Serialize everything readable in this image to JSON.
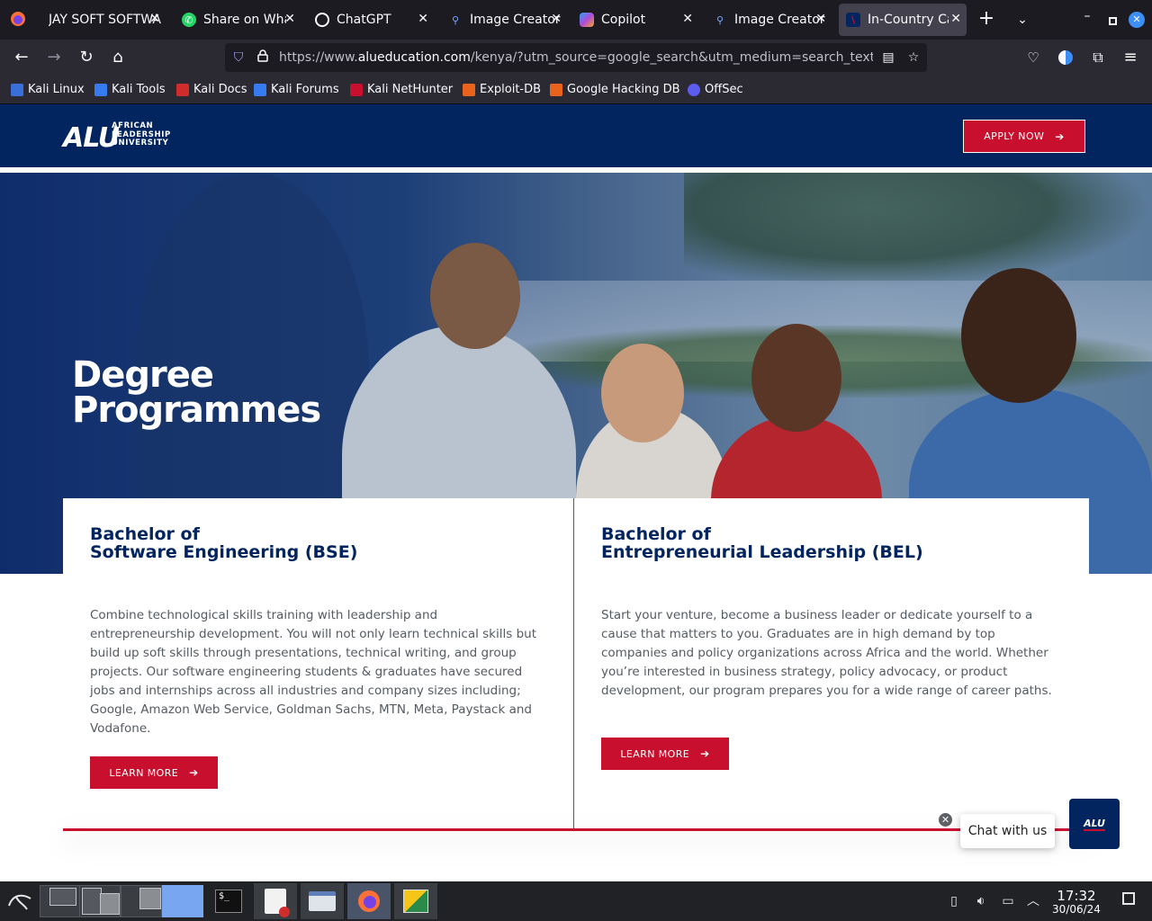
{
  "browser": {
    "tabs": [
      {
        "title": "JAY SOFT SOFTWA",
        "icon": "firefox-icon"
      },
      {
        "title": "Share on Wha",
        "icon": "whatsapp-icon"
      },
      {
        "title": "ChatGPT",
        "icon": "chatgpt-icon"
      },
      {
        "title": "Image Creator",
        "icon": "search-icon"
      },
      {
        "title": "Copilot",
        "icon": "copilot-icon"
      },
      {
        "title": "Image Creator",
        "icon": "search-icon"
      },
      {
        "title": "In-Country Ca",
        "icon": "alu-favicon",
        "active": true
      }
    ],
    "url_prefix": "https://www.",
    "url_domain": "alueducation.com",
    "url_rest": "/kenya/?utm_source=google_search&utm_medium=search_text&utm_",
    "bookmarks": [
      {
        "label": "Kali Linux",
        "color": "#3a6ed8"
      },
      {
        "label": "Kali Tools",
        "color": "#367bf0"
      },
      {
        "label": "Kali Docs",
        "color": "#d02c2c"
      },
      {
        "label": "Kali Forums",
        "color": "#367bf0"
      },
      {
        "label": "Kali NetHunter",
        "color": "#c8102e"
      },
      {
        "label": "Exploit-DB",
        "color": "#e8641c"
      },
      {
        "label": "Google Hacking DB",
        "color": "#e8641c"
      },
      {
        "label": "OffSec",
        "color": "#5c5cf0"
      }
    ]
  },
  "site": {
    "logo_mark": "ALU",
    "logo_line1": "AFRICAN",
    "logo_line2": "LEADERSHIP",
    "logo_line3": "UNIVERSITY",
    "apply_label": "APPLY NOW",
    "hero_title_1": "Degree",
    "hero_title_2": "Programmes",
    "cards": [
      {
        "title_1": "Bachelor of",
        "title_2": "Software Engineering (BSE)",
        "body": "Combine technological skills training with leadership and entrepreneurship development. You will not only learn technical skills but build up soft skills through presentations, technical writing, and group projects. Our software engineering students & graduates have secured jobs and internships across all industries and company sizes including; Google, Amazon Web Service, Goldman Sachs, MTN, Meta, Paystack and Vodafone.",
        "button": "LEARN MORE"
      },
      {
        "title_1": "Bachelor of",
        "title_2": "Entrepreneurial Leadership (BEL)",
        "body": "Start your venture, become a business leader or dedicate yourself to a cause that matters to you.  Graduates are in high demand by top companies and policy organizations across Africa and the world. Whether you’re interested in business strategy, policy advocacy, or product development, our program prepares you for a wide range of career paths.",
        "button": "LEARN MORE"
      }
    ],
    "chat_label": "Chat with us",
    "chat_launcher_text": "ALU"
  },
  "taskbar": {
    "time": "17:32",
    "date": "30/06/24"
  },
  "colors": {
    "navy": "#022560",
    "red": "#c8102e"
  }
}
